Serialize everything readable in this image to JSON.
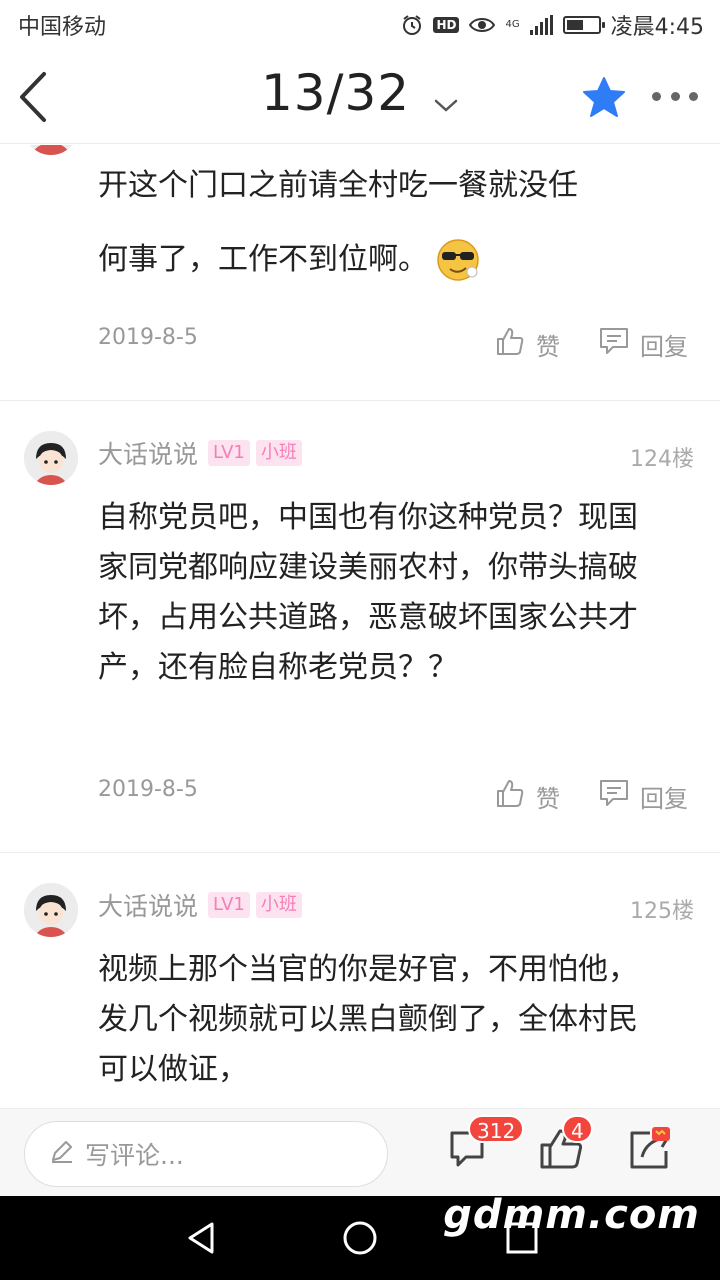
{
  "status_bar": {
    "carrier": "中国移动",
    "network": "4G",
    "hd": "HD",
    "time": "凌晨4:45"
  },
  "nav": {
    "page_indicator": "13/32",
    "icons": [
      "back-icon",
      "chevron-down-icon",
      "star-icon",
      "more-icon"
    ],
    "accent_color": "#2e7cf6"
  },
  "comments": [
    {
      "text_lines": [
        "开这个门口之前请全村吃一餐就没任",
        "何事了，工作不到位啊。"
      ],
      "emoji": "cool-face-emoji",
      "date": "2019-8-5",
      "like_label": "赞",
      "reply_label": "回复"
    },
    {
      "username": "大话说说",
      "level": "LV1",
      "rank": "小班",
      "floor": "124楼",
      "text": "自称党员吧，中国也有你这种党员？现国家同党都响应建设美丽农村，你带头搞破坏，占用公共道路，恶意破坏国家公共才产，还有脸自称老党员？？",
      "date": "2019-8-5",
      "like_label": "赞",
      "reply_label": "回复"
    },
    {
      "username": "大话说说",
      "level": "LV1",
      "rank": "小班",
      "floor": "125楼",
      "text": "视频上那个当官的你是好官，不用怕他，发几个视频就可以黑白颤倒了，全体村民可以做证，"
    }
  ],
  "bottom_bar": {
    "input_placeholder": "写评论...",
    "comment_count": "312",
    "like_count": "4"
  },
  "watermark": "gdmm.com"
}
